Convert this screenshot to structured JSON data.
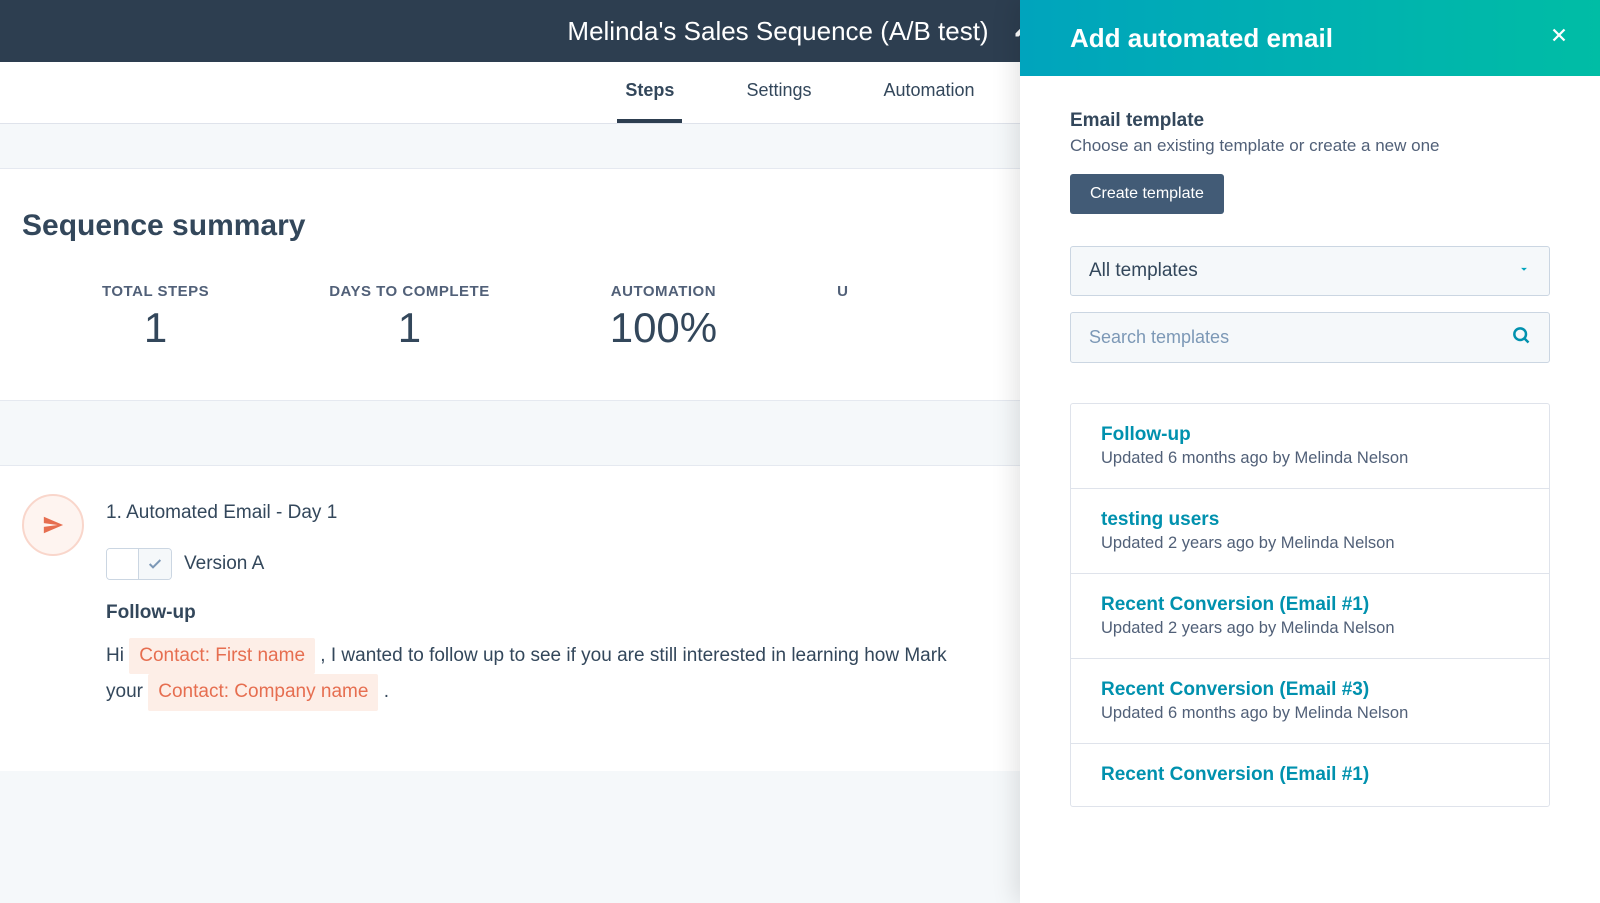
{
  "header": {
    "title": "Melinda's Sales Sequence (A/B test)"
  },
  "tabs": [
    {
      "label": "Steps",
      "active": true
    },
    {
      "label": "Settings",
      "active": false
    },
    {
      "label": "Automation",
      "active": false
    }
  ],
  "summary": {
    "title": "Sequence summary",
    "stats": [
      {
        "label": "TOTAL STEPS",
        "value": "1"
      },
      {
        "label": "DAYS TO COMPLETE",
        "value": "1"
      },
      {
        "label": "AUTOMATION",
        "value": "100%"
      },
      {
        "label": "U",
        "value": ""
      }
    ]
  },
  "step": {
    "title": "1. Automated Email - Day 1",
    "version_label": "Version A",
    "email_subject": "Follow-up",
    "body_prefix": "Hi ",
    "token1": "Contact: First name",
    "body_mid": " , I wanted to follow up to see if you are still interested in learning how Mark",
    "body_line2_prefix": "your ",
    "token2": "Contact: Company name",
    "body_suffix": " ."
  },
  "panel": {
    "title": "Add automated email",
    "section_label": "Email template",
    "section_sub": "Choose an existing template or create a new one",
    "create_button": "Create template",
    "filter_selected": "All templates",
    "search_placeholder": "Search templates",
    "templates": [
      {
        "name": "Follow-up",
        "meta": "Updated 6 months ago by Melinda Nelson"
      },
      {
        "name": "testing users",
        "meta": "Updated 2 years ago by Melinda Nelson"
      },
      {
        "name": "Recent Conversion (Email #1)",
        "meta": "Updated 2 years ago by Melinda Nelson"
      },
      {
        "name": "Recent Conversion (Email #3)",
        "meta": "Updated 6 months ago by Melinda Nelson"
      },
      {
        "name": "Recent Conversion (Email #1)",
        "meta": ""
      }
    ]
  }
}
